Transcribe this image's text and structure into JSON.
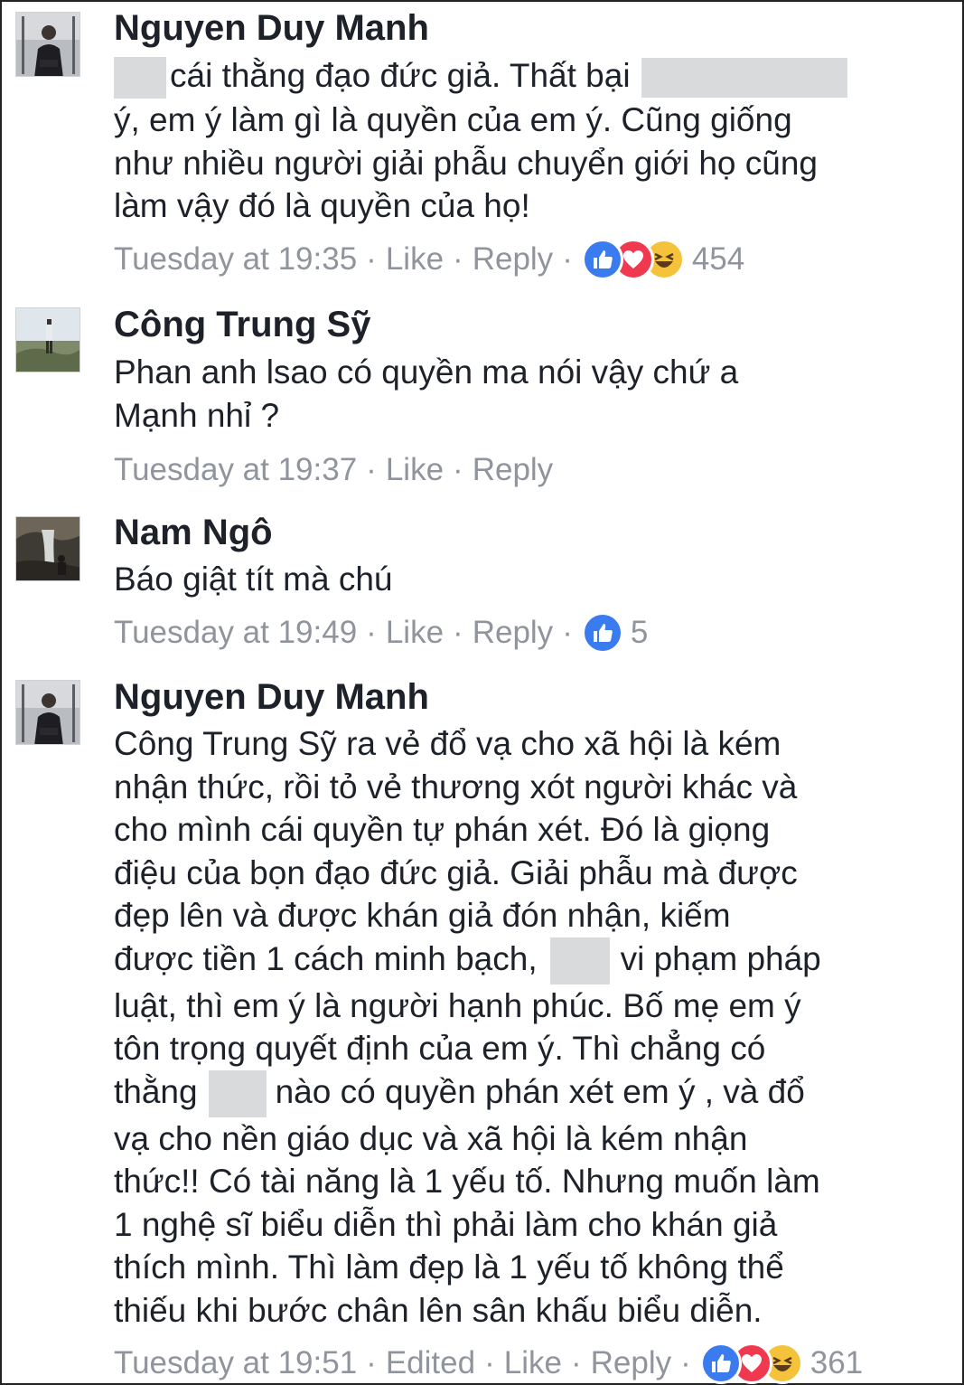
{
  "comments": [
    {
      "author": "Nguyen Duy Manh",
      "lines": [
        "cái thằng đạo đức giả. Thất bại",
        "ý, em ý làm gì là quyền của em ý. Cũng giống",
        "như nhiều người giải phẫu chuyển giới họ cũng",
        "làm vậy đó là quyền của họ!"
      ],
      "time": "Tuesday at 19:35",
      "like_label": "Like",
      "reply_label": "Reply",
      "reaction_icons": [
        "like-icon",
        "love-icon",
        "haha-icon"
      ],
      "reaction_count": "454"
    },
    {
      "author": "Công Trung Sỹ",
      "lines": [
        "Phan anh lsao có quyền ma nói vậy chứ a",
        "Mạnh nhỉ ?"
      ],
      "time": "Tuesday at 19:37",
      "like_label": "Like",
      "reply_label": "Reply"
    },
    {
      "author": "Nam Ngô",
      "lines": [
        "Báo giật tít mà chú"
      ],
      "time": "Tuesday at 19:49",
      "like_label": "Like",
      "reply_label": "Reply",
      "reaction_icons": [
        "like-icon"
      ],
      "reaction_count": "5"
    },
    {
      "author": "Nguyen Duy Manh",
      "lines": [
        "Công Trung Sỹ ra vẻ đổ vạ cho xã hội là kém",
        "nhận thức, rồi tỏ vẻ thương xót người khác và",
        "cho mình cái quyền tự phán xét. Đó là giọng",
        "điệu của bọn đạo đức giả. Giải phẫu mà được",
        "đẹp lên và được khán giả đón nhận,  kiếm",
        "được tiền 1 cách minh bạch,",
        "vi phạm pháp",
        "luật, thì em ý là người hạnh phúc. Bố mẹ em ý",
        "tôn trọng quyết định của em ý. Thì chẳng có",
        "thằng",
        "nào có quyền phán xét em ý , và đổ",
        "vạ cho nền giáo dục và xã hội là kém nhận",
        "thức!! Có tài năng là 1 yếu tố. Nhưng muốn làm",
        "1 nghệ sĩ biểu diễn thì phải làm cho khán giả",
        "thích mình. Thì làm đẹp là 1 yếu tố không thể",
        "thiếu khi bước chân lên sân khấu biểu diễn."
      ],
      "time": "Tuesday at 19:51",
      "edited_label": "Edited",
      "like_label": "Like",
      "reply_label": "Reply",
      "reaction_icons": [
        "like-icon",
        "love-icon",
        "haha-icon"
      ],
      "reaction_count": "361"
    }
  ],
  "colors": {
    "name": "#1d2129",
    "meta": "#90949c",
    "like": "#3b7bf0",
    "love": "#f0384f",
    "haha": "#f5c33b",
    "redaction": "#d9dadc"
  }
}
